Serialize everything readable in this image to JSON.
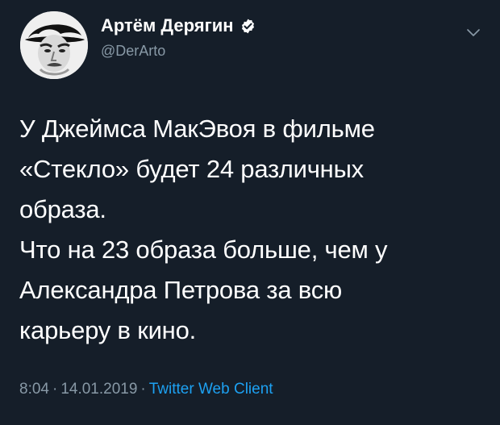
{
  "tweet": {
    "display_name": "Артём Дерягин",
    "username": "@DerArto",
    "lines": [
      "У Джеймса МакЭвоя в фильме",
      "«Стекло» будет 24 различных",
      "образа.",
      "Что на 23 образа больше, чем у",
      "Александра Петрова за всю",
      "карьеру в кино."
    ],
    "time": "8:04",
    "date": "14.01.2019",
    "separator": "·",
    "source": "Twitter Web Client",
    "icons": {
      "verified": "verified-badge-icon",
      "menu": "chevron-down-icon",
      "avatar": "avatar-image"
    },
    "colors": {
      "background": "#151e29",
      "text": "#ffffff",
      "secondary": "#8899a6",
      "accent": "#1da1f2"
    }
  }
}
